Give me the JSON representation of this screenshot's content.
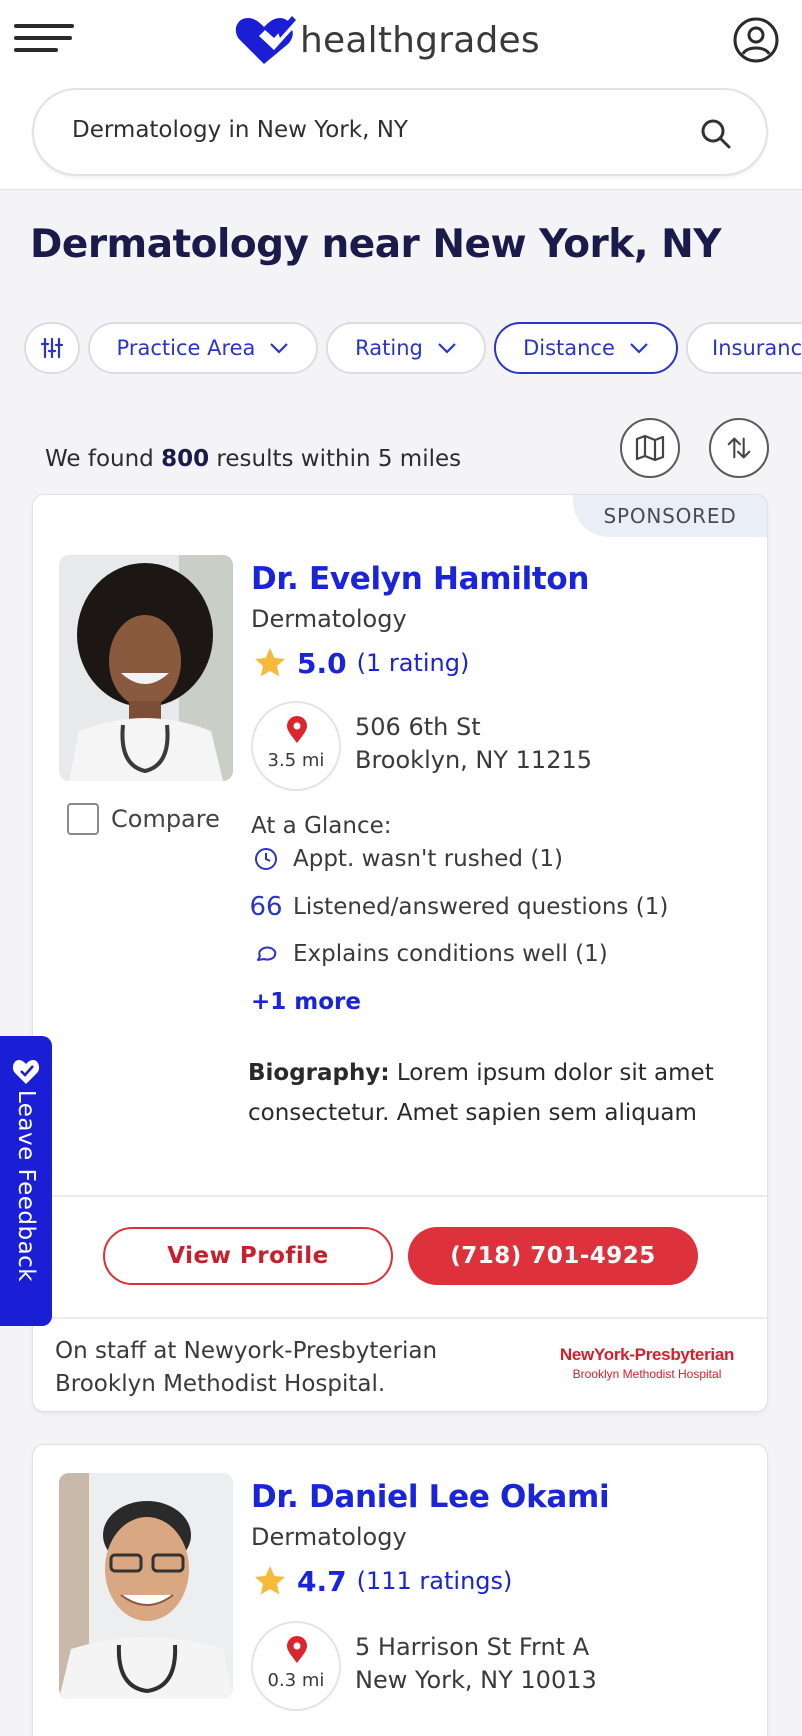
{
  "header": {
    "brand": "healthgrades",
    "menu_icon": "hamburger-menu-icon",
    "account_icon": "user-account-icon"
  },
  "search": {
    "value": "Dermatology in New York, NY",
    "icon": "search-icon"
  },
  "page_title": "Dermatology near New York, NY",
  "filters": {
    "filter_icon": "sliders-icon",
    "chips": [
      "Practice Area",
      "Rating",
      "Distance",
      "Insurance"
    ],
    "active": "Distance"
  },
  "results": {
    "prefix": "We found",
    "count": "800",
    "suffix": "results within 5 miles",
    "map_icon": "map-icon",
    "sort_icon": "sort-icon"
  },
  "providers": [
    {
      "sponsored_label": "SPONSORED",
      "name": "Dr. Evelyn Hamilton",
      "specialty": "Dermatology",
      "score": "5.0",
      "rating_count": "(1 rating)",
      "distance": "3.5 mi",
      "address_line1": "506 6th St",
      "address_line2": "Brooklyn, NY 11215",
      "compare_label": "Compare",
      "glance_title": "At a Glance:",
      "glance": [
        {
          "icon": "clock-icon",
          "text": "Appt. wasn't rushed (1)"
        },
        {
          "icon": "quote-icon",
          "text": "Listened/answered questions (1)"
        },
        {
          "icon": "chat-bubble-icon",
          "text": "Explains conditions well (1)"
        }
      ],
      "more_label": "+1 more",
      "bio_label": "Biography:",
      "bio_text": "Lorem ipsum dolor sit amet consectetur. Amet sapien sem aliquam",
      "view_profile_label": "View Profile",
      "phone": "(718) 701-4925",
      "staff_line1": "On staff at Newyork-Presbyterian",
      "staff_line2": "Brooklyn Methodist Hospital.",
      "hospital_logo_line1": "NewYork-Presbyterian",
      "hospital_logo_line2": "Brooklyn Methodist Hospital"
    },
    {
      "name": "Dr. Daniel Lee Okami",
      "specialty": "Dermatology",
      "score": "4.7",
      "rating_count": "(111 ratings)",
      "distance": "0.3 mi",
      "address_line1": "5 Harrison St Frnt A",
      "address_line2": "New York, NY 10013"
    }
  ],
  "feedback_tab": "Leave Feedback",
  "colors": {
    "brand_blue": "#1a24d8",
    "heading_navy": "#1a1b4b",
    "accent_red": "#dd313b",
    "star_gold": "#f6b93b"
  }
}
